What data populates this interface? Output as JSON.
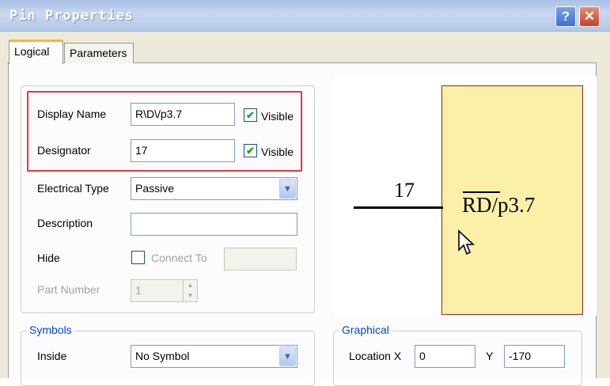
{
  "window": {
    "title": "Pin Properties",
    "help_glyph": "?",
    "close_glyph": "✕"
  },
  "tabs": [
    {
      "label": "Logical",
      "active": true
    },
    {
      "label": "Parameters",
      "active": false
    }
  ],
  "fields": {
    "display_name": {
      "label": "Display Name",
      "value": "R\\D\\/p3.7",
      "visible_label": "Visible",
      "visible": true
    },
    "designator": {
      "label": "Designator",
      "value": "17",
      "visible_label": "Visible",
      "visible": true
    },
    "electrical_type": {
      "label": "Electrical Type",
      "value": "Passive"
    },
    "description": {
      "label": "Description",
      "value": ""
    },
    "hide": {
      "label": "Hide",
      "checked": false,
      "connect_to_label": "Connect To",
      "connect_to_value": ""
    },
    "part_number": {
      "label": "Part Number",
      "value": "1"
    }
  },
  "symbols": {
    "title": "Symbols",
    "inside_label": "Inside",
    "inside_value": "No Symbol"
  },
  "graphical": {
    "title": "Graphical",
    "location_label": "Location X",
    "x_value": "0",
    "y_label": "Y",
    "y_value": "-170"
  },
  "preview": {
    "pin_number": "17",
    "pin_name_over": "RD",
    "pin_name_rest": "/p3.7"
  },
  "colors": {
    "highlight": "#e0393e",
    "part_fill": "#faf0a8",
    "part_border": "#8b2a2a",
    "group_title": "#0046d5"
  }
}
